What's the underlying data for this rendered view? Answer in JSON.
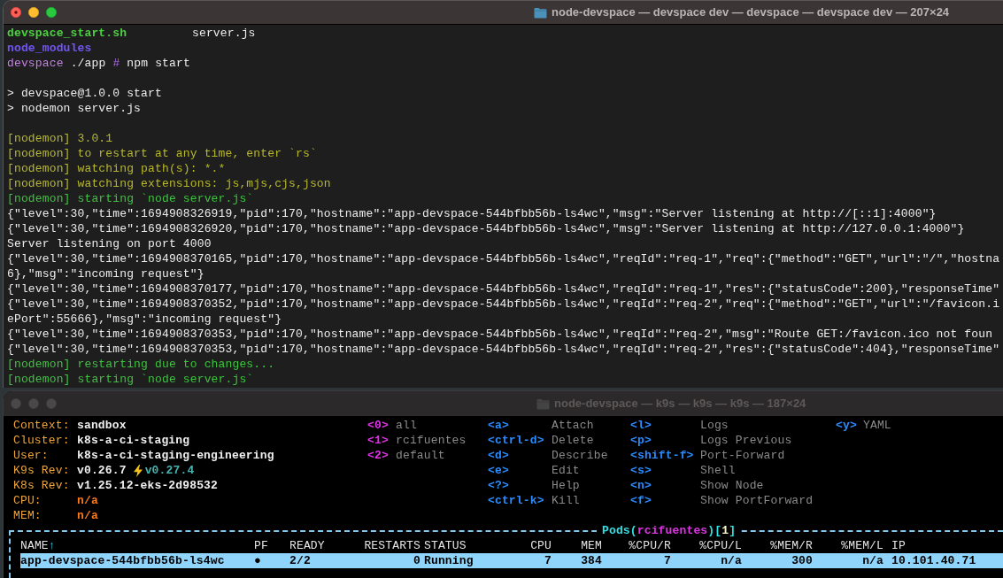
{
  "terminal_window": {
    "title": "node-devspace — devspace dev — devspace — devspace dev — 207×24",
    "active": true,
    "blocks": [
      {
        "lines": [
          {
            "kind": "files",
            "files": [
              {
                "name": "devspace_start.sh",
                "kind": "executable"
              },
              {
                "name": "server.js",
                "kind": "file"
              }
            ]
          },
          {
            "kind": "files",
            "files": [
              {
                "name": "node_modules",
                "kind": "directory"
              }
            ]
          },
          {
            "kind": "prompt",
            "host": "devspace",
            "cwd": "./app",
            "symbol": "#",
            "command": "npm start"
          }
        ]
      },
      {
        "lines": [
          {
            "kind": "output",
            "text": "> devspace@1.0.0 start"
          },
          {
            "kind": "output",
            "text": "> nodemon server.js"
          }
        ]
      },
      {
        "lines": [
          {
            "kind": "nodemon",
            "text": "[nodemon] 3.0.1"
          },
          {
            "kind": "nodemon",
            "text": "[nodemon] to restart at any time, enter `rs`"
          },
          {
            "kind": "nodemon",
            "text": "[nodemon] watching path(s): *.*"
          },
          {
            "kind": "nodemon",
            "text": "[nodemon] watching extensions: js,mjs,cjs,json"
          },
          {
            "kind": "nodemon_event",
            "text": "[nodemon] starting `node server.js`"
          },
          {
            "kind": "output",
            "text": "{\"level\":30,\"time\":1694908326919,\"pid\":170,\"hostname\":\"app-devspace-544bfbb56b-ls4wc\",\"msg\":\"Server listening at http://[::1]:4000\"}"
          },
          {
            "kind": "output",
            "text": "{\"level\":30,\"time\":1694908326920,\"pid\":170,\"hostname\":\"app-devspace-544bfbb56b-ls4wc\",\"msg\":\"Server listening at http://127.0.0.1:4000\"}"
          },
          {
            "kind": "output",
            "text": "Server listening on port 4000"
          },
          {
            "kind": "output",
            "text": "{\"level\":30,\"time\":1694908370165,\"pid\":170,\"hostname\":\"app-devspace-544bfbb56b-ls4wc\",\"reqId\":\"req-1\",\"req\":{\"method\":\"GET\",\"url\":\"/\",\"hostna"
          },
          {
            "kind": "output",
            "text": "6},\"msg\":\"incoming request\"}"
          },
          {
            "kind": "output",
            "text": "{\"level\":30,\"time\":1694908370177,\"pid\":170,\"hostname\":\"app-devspace-544bfbb56b-ls4wc\",\"reqId\":\"req-1\",\"res\":{\"statusCode\":200},\"responseTime\""
          },
          {
            "kind": "output",
            "text": "{\"level\":30,\"time\":1694908370352,\"pid\":170,\"hostname\":\"app-devspace-544bfbb56b-ls4wc\",\"reqId\":\"req-2\",\"req\":{\"method\":\"GET\",\"url\":\"/favicon.i"
          },
          {
            "kind": "output",
            "text": "ePort\":55666},\"msg\":\"incoming request\"}"
          },
          {
            "kind": "output",
            "text": "{\"level\":30,\"time\":1694908370353,\"pid\":170,\"hostname\":\"app-devspace-544bfbb56b-ls4wc\",\"reqId\":\"req-2\",\"msg\":\"Route GET:/favicon.ico not foun"
          },
          {
            "kind": "output",
            "text": "{\"level\":30,\"time\":1694908370353,\"pid\":170,\"hostname\":\"app-devspace-544bfbb56b-ls4wc\",\"reqId\":\"req-2\",\"res\":{\"statusCode\":404},\"responseTime\""
          },
          {
            "kind": "nodemon_event",
            "text": "[nodemon] restarting due to changes..."
          },
          {
            "kind": "nodemon_event",
            "text": "[nodemon] starting `node server.js`"
          }
        ]
      }
    ]
  },
  "k9s_window": {
    "title": "node-devspace — k9s — k9s — k9s — 187×24",
    "active": false,
    "cluster_info": [
      {
        "label": "Context:",
        "value": "sandbox",
        "kind": "plain"
      },
      {
        "label": "Cluster:",
        "value": "k8s-a-ci-staging",
        "kind": "plain"
      },
      {
        "label": "User:",
        "value": "k8s-a-ci-staging-engineering",
        "kind": "plain"
      },
      {
        "label": "K9s Rev:",
        "value": "v0.26.7",
        "upgrade": "v0.27.4",
        "kind": "version"
      },
      {
        "label": "K8s Rev:",
        "value": "v1.25.12-eks-2d98532",
        "kind": "plain"
      },
      {
        "label": "CPU:",
        "value": "n/a",
        "kind": "metric"
      },
      {
        "label": "MEM:",
        "value": "n/a",
        "kind": "metric"
      }
    ],
    "namespaces": [
      {
        "key": "<0>",
        "name": "all"
      },
      {
        "key": "<1>",
        "name": "rcifuentes"
      },
      {
        "key": "<2>",
        "name": "default"
      }
    ],
    "shortcut_columns": [
      [
        {
          "key": "<a>",
          "action": "Attach"
        },
        {
          "key": "<ctrl-d>",
          "action": "Delete"
        },
        {
          "key": "<d>",
          "action": "Describe"
        },
        {
          "key": "<e>",
          "action": "Edit"
        },
        {
          "key": "<?>",
          "action": "Help"
        },
        {
          "key": "<ctrl-k>",
          "action": "Kill"
        }
      ],
      [
        {
          "key": "<l>",
          "action": "Logs"
        },
        {
          "key": "<p>",
          "action": "Logs Previous"
        },
        {
          "key": "<shift-f>",
          "action": "Port-Forward"
        },
        {
          "key": "<s>",
          "action": "Shell"
        },
        {
          "key": "<n>",
          "action": "Show Node"
        },
        {
          "key": "<f>",
          "action": "Show PortForward"
        }
      ],
      [
        {
          "key": "<y>",
          "action": "YAML"
        }
      ]
    ],
    "pods_table": {
      "title": [
        {
          "text": "Pods",
          "kind": "resource"
        },
        {
          "text": "(",
          "kind": "bracket"
        },
        {
          "text": "rcifuentes",
          "kind": "namespace"
        },
        {
          "text": ")[",
          "kind": "bracket"
        },
        {
          "text": "1",
          "kind": "count"
        },
        {
          "text": "]",
          "kind": "bracket"
        }
      ],
      "columns": [
        {
          "label": "NAME",
          "sort_indicator": "↑"
        },
        {
          "label": "PF"
        },
        {
          "label": "READY"
        },
        {
          "label": "RESTARTS"
        },
        {
          "label": "STATUS"
        },
        {
          "label": "CPU"
        },
        {
          "label": "MEM"
        },
        {
          "label": "%CPU/R"
        },
        {
          "label": "%CPU/L"
        },
        {
          "label": "%MEM/R"
        },
        {
          "label": "%MEM/L"
        },
        {
          "label": "IP"
        }
      ],
      "rows": [
        {
          "selected": true,
          "cells": [
            "app-devspace-544bfbb56b-ls4wc",
            "●",
            "2/2",
            "0",
            "Running",
            "7",
            "384",
            "7",
            "n/a",
            "300",
            "n/a",
            "10.101.40.71"
          ]
        }
      ]
    }
  }
}
